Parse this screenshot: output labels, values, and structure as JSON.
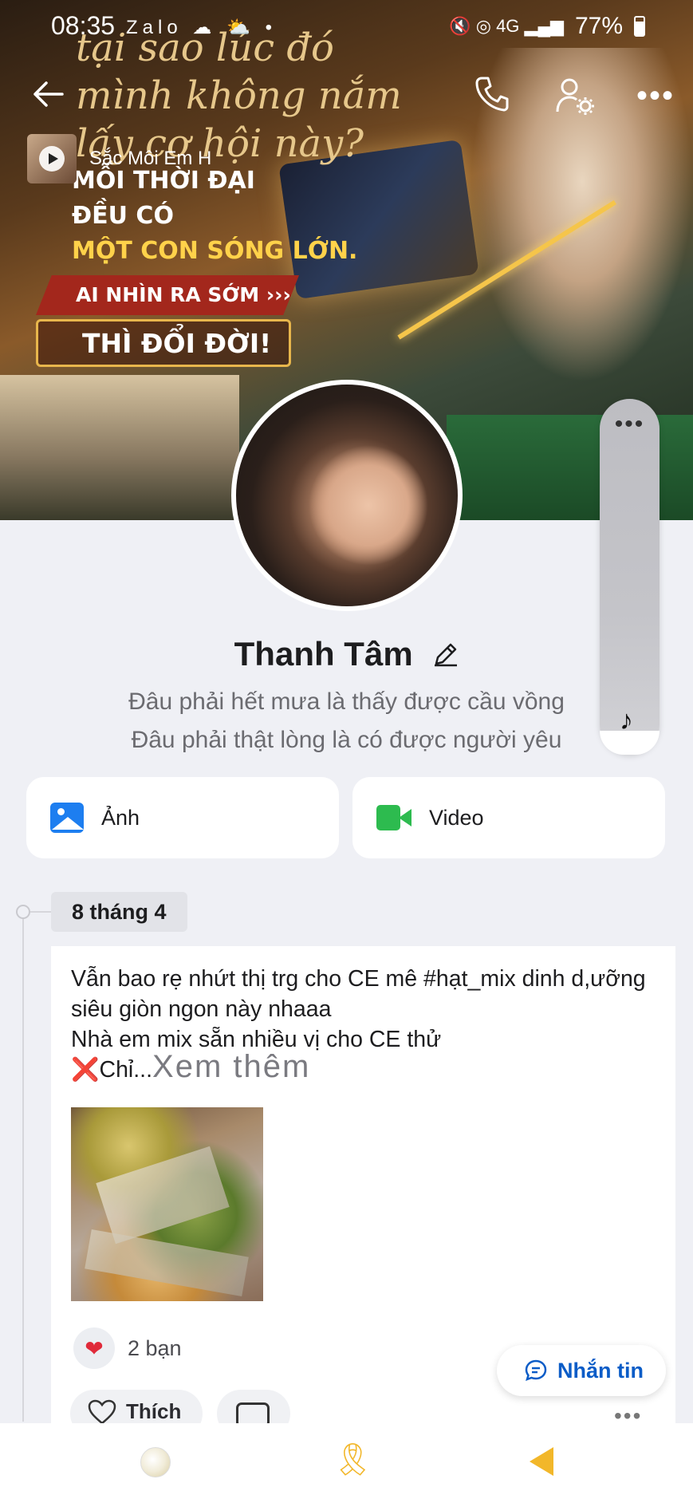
{
  "status_bar": {
    "time": "08:35",
    "left_icons": "Zalo ☁ ⛅ •",
    "right_icons": "🔇 ◎ 4G ▂▄▆",
    "battery": "77%"
  },
  "cover": {
    "script_text": "tại sao lúc đó\nmình không nắm\nlấy cơ hội này?",
    "question_mark": "?",
    "headline_1": "MỖI THỜI ĐẠI",
    "headline_2": "ĐỀU CÓ",
    "headline_3": "MỘT CON SÓNG LỚN.",
    "banner_1": "AI NHÌN RA SỚM  ›››",
    "banner_2": "THÌ ĐỔI ĐỜI!"
  },
  "music": {
    "title": "Sắc Môi Em H"
  },
  "profile": {
    "name": "Thanh Tâm",
    "bio_line_1": "Đâu phải hết mưa là thấy được cầu vồng",
    "bio_line_2": "Đâu phải thật lòng là có được người yêu"
  },
  "side_panel": {
    "dots": "•••",
    "note_icon": "♪"
  },
  "media_buttons": {
    "photo_label": "Ảnh",
    "video_label": "Video"
  },
  "timeline": {
    "date": "8 tháng 4"
  },
  "post": {
    "line_1": "Vẫn bao rẹ nhứt thị trg cho CE mê #hạt_mix dinh d,ưỡng siêu giòn ngon này nhaaa",
    "line_2": "Nhà em mix sẵn nhiều vị cho CE thử",
    "x_mark": "❌",
    "truncated": "Chỉ...",
    "see_more": "Xem thêm",
    "reaction_icon": "❤",
    "reaction_count": "2 bạn",
    "like_label": "Thích",
    "more_dots": "•••"
  },
  "message_button": {
    "label": "Nhắn tin"
  },
  "colors": {
    "accent_blue": "#0a5cc7",
    "photo_icon": "#1d7ef0",
    "video_icon": "#2dbb4f",
    "nav_yellow": "#f2b72a"
  }
}
